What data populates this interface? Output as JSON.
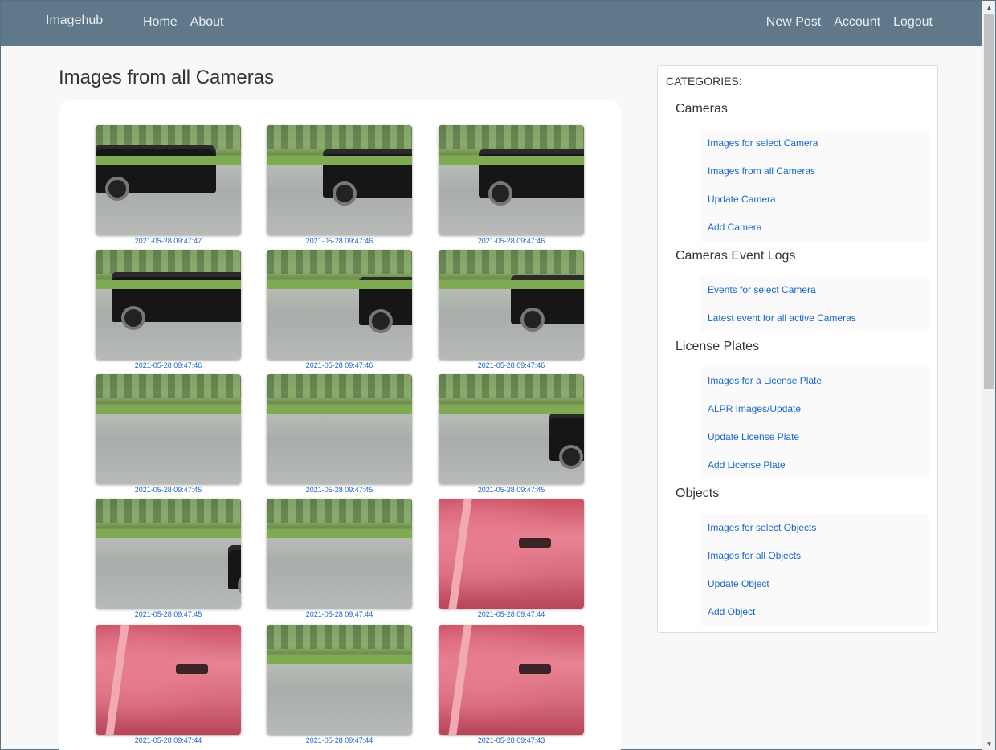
{
  "navbar": {
    "brand": "Imagehub",
    "left_links": [
      "Home",
      "About"
    ],
    "right_links": [
      "New Post",
      "Account",
      "Logout"
    ]
  },
  "main": {
    "title": "Images from all Cameras",
    "images": [
      {
        "timestamp": "2021-05-28 09:47:47",
        "scene": "street-truck"
      },
      {
        "timestamp": "2021-05-28 09:47:46",
        "scene": "street-truck"
      },
      {
        "timestamp": "2021-05-28 09:47:46",
        "scene": "street-truck"
      },
      {
        "timestamp": "2021-05-28 09:47:46",
        "scene": "street-truck"
      },
      {
        "timestamp": "2021-05-28 09:47:46",
        "scene": "street-truck"
      },
      {
        "timestamp": "2021-05-28 09:47:46",
        "scene": "street-truck"
      },
      {
        "timestamp": "2021-05-28 09:47:45",
        "scene": "street"
      },
      {
        "timestamp": "2021-05-28 09:47:45",
        "scene": "street"
      },
      {
        "timestamp": "2021-05-28 09:47:45",
        "scene": "street-truck"
      },
      {
        "timestamp": "2021-05-28 09:47:45",
        "scene": "street-truck"
      },
      {
        "timestamp": "2021-05-28 09:47:44",
        "scene": "street"
      },
      {
        "timestamp": "2021-05-28 09:47:44",
        "scene": "red"
      },
      {
        "timestamp": "2021-05-28 09:47:44",
        "scene": "red"
      },
      {
        "timestamp": "2021-05-28 09:47:44",
        "scene": "street"
      },
      {
        "timestamp": "2021-05-28 09:47:43",
        "scene": "red"
      }
    ]
  },
  "sidebar": {
    "heading": "CATEGORIES:",
    "categories": [
      {
        "title": "Cameras",
        "items": [
          "Images for select Camera",
          "Images from all Cameras",
          "Update Camera",
          "Add Camera"
        ]
      },
      {
        "title": "Cameras Event Logs",
        "items": [
          "Events for select Camera",
          "Latest event for all active Cameras"
        ]
      },
      {
        "title": "License Plates",
        "items": [
          "Images for a License Plate",
          "ALPR Images/Update",
          "Update License Plate",
          "Add License Plate"
        ]
      },
      {
        "title": "Objects",
        "items": [
          "Images for select Objects",
          "Images for all Objects",
          "Update Object",
          "Add Object"
        ]
      }
    ]
  },
  "colors": {
    "navbar_bg": "#5f788a",
    "link": "#1a66c8"
  }
}
